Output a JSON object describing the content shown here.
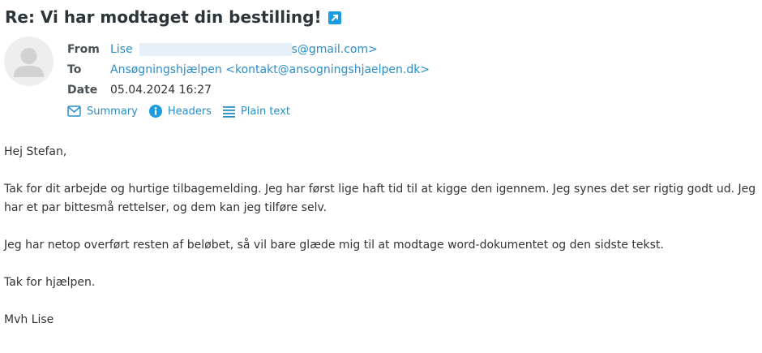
{
  "message": {
    "subject": "Re: Vi har modtaget din bestilling!",
    "headers": {
      "from_label": "From",
      "from_name": "Lise",
      "from_email_suffix": "s@gmail.com>",
      "to_label": "To",
      "to_value": "Ansøgningshjælpen <kontakt@ansogningshjaelpen.dk>",
      "date_label": "Date",
      "date_value": "05.04.2024 16:27"
    },
    "actions": {
      "summary": "Summary",
      "headers": "Headers",
      "plain_text": "Plain text"
    },
    "body": {
      "p1": "Hej Stefan,",
      "p2": "Tak for dit arbejde og hurtige tilbagemelding. Jeg har først lige haft tid til at kigge den igennem. Jeg synes det ser rigtig godt ud. Jeg har et par bittesmå rettelser, og dem kan jeg tilføre selv.",
      "p3": "Jeg har netop overført resten af beløbet, så vil bare glæde mig til at modtage word-dokumentet og den sidste tekst.",
      "p4": "Tak for hjælpen.",
      "p5": "Mvh Lise"
    }
  },
  "colors": {
    "link": "#2a8ec7",
    "accent": "#1a9de0",
    "redaction": "#e6f0f8"
  },
  "icons": [
    "open-in-new-window-icon",
    "contact-avatar-icon",
    "envelope-icon",
    "info-icon",
    "list-lines-icon"
  ]
}
